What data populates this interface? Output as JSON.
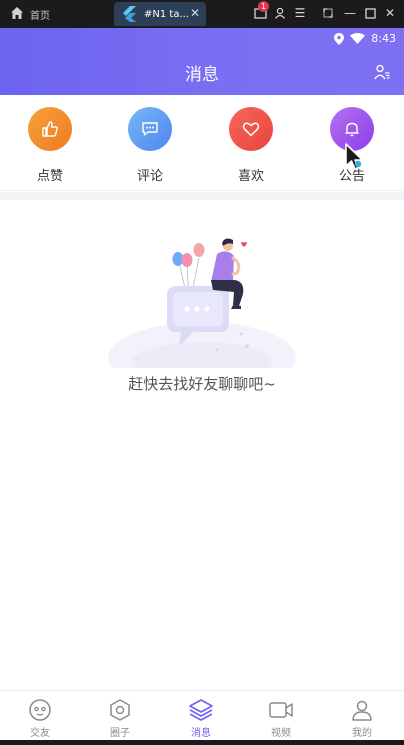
{
  "window": {
    "home_tab": "首页",
    "app_tab": "#N1 ta...",
    "notif_count": "1"
  },
  "status": {
    "time": "8:43"
  },
  "header": {
    "title": "消息"
  },
  "actions": [
    {
      "label": "点赞",
      "color_from": "#f6a23b",
      "color_to": "#ee7a22",
      "icon": "thumbs-up-icon"
    },
    {
      "label": "评论",
      "color_from": "#7ab6f7",
      "color_to": "#4b86ee",
      "icon": "comment-icon"
    },
    {
      "label": "喜欢",
      "color_from": "#f6665a",
      "color_to": "#e8453c",
      "icon": "heart-icon"
    },
    {
      "label": "公告",
      "color_from": "#b570f2",
      "color_to": "#8b3fe8",
      "icon": "bell-icon"
    }
  ],
  "empty_state": {
    "text": "赶快去找好友聊聊吧~"
  },
  "bottom_nav": {
    "items": [
      {
        "label": "交友",
        "active": false
      },
      {
        "label": "圈子",
        "active": false
      },
      {
        "label": "消息",
        "active": true
      },
      {
        "label": "视频",
        "active": false
      },
      {
        "label": "我的",
        "active": false
      }
    ]
  },
  "colors": {
    "accent": "#6c63f0",
    "inactive": "#8b8b8b"
  }
}
